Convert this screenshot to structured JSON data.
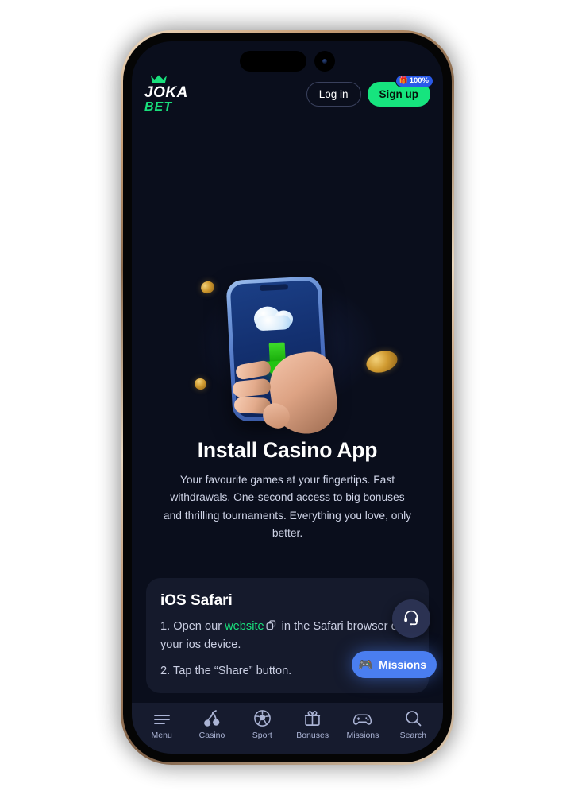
{
  "device": {
    "frame_color": "#c9a077",
    "screen_bg": "#0a0e1c"
  },
  "header": {
    "logo": {
      "line1": "JOKA",
      "line2": "BET",
      "crown_icon": "crown-icon"
    },
    "login_label": "Log in",
    "signup_label": "Sign up",
    "signup_badge": {
      "icon": "gift-icon",
      "text": "100%",
      "color": "#2a5ae8"
    },
    "accent_green": "#16e47e"
  },
  "hero": {
    "illustration": "hand-holding-phone-cloud-download-illustration",
    "title": "Install Casino App",
    "subtitle": "Your favourite games at your fingertips. Fast withdrawals. One-second access to big bonuses and thrilling tournaments. Everything you love, only better."
  },
  "card": {
    "title": "iOS Safari",
    "step1_prefix": "1. Open our ",
    "step1_link": "website",
    "step1_link_icon": "external-link-icon",
    "step1_suffix": " in the Safari browser on your ios device.",
    "step2": "2. Tap the “Share” button.",
    "link_color": "#19e07c"
  },
  "floating": {
    "support_icon": "headset-icon",
    "missions_label": "Missions",
    "missions_icon": "gamepad-icon",
    "missions_color": "#4a7ef0"
  },
  "bottom_nav": {
    "items": [
      {
        "label": "Menu",
        "icon": "hamburger-menu-icon"
      },
      {
        "label": "Casino",
        "icon": "cherries-icon"
      },
      {
        "label": "Sport",
        "icon": "soccer-ball-icon"
      },
      {
        "label": "Bonuses",
        "icon": "gift-box-icon"
      },
      {
        "label": "Missions",
        "icon": "gamepad-icon"
      },
      {
        "label": "Search",
        "icon": "magnifier-icon"
      }
    ]
  }
}
